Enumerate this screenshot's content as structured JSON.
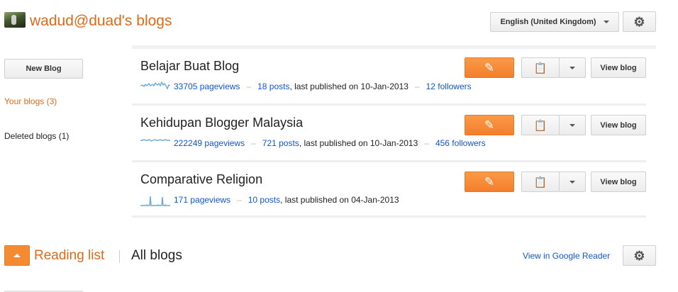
{
  "header": {
    "title": "wadud@duad's blogs",
    "language": "English (United Kingdom)"
  },
  "sidebar": {
    "new_blog": "New Blog",
    "items": [
      {
        "label": "Your blogs (3)",
        "active": true
      },
      {
        "label": "Deleted blogs (1)",
        "active": false
      }
    ]
  },
  "blogs": [
    {
      "title": "Belajar Buat Blog",
      "pageviews": "33705 pageviews",
      "posts": "18 posts",
      "published": ", last published on 10-Jan-2013",
      "followers": "12 followers",
      "view": "View blog"
    },
    {
      "title": "Kehidupan Blogger Malaysia",
      "pageviews": "222249 pageviews",
      "posts": "721 posts",
      "published": ", last published on 10-Jan-2013",
      "followers": "456 followers",
      "view": "View blog"
    },
    {
      "title": "Comparative Religion",
      "pageviews": "171 pageviews",
      "posts": "10 posts",
      "published": ", last published on 04-Jan-2013",
      "followers": "",
      "view": "View blog"
    }
  ],
  "reading": {
    "title": "Reading list",
    "all_blogs": "All blogs",
    "reader_link": "View in Google Reader"
  },
  "icons": {
    "gear": "gear-icon",
    "pencil": "pencil-icon",
    "posts": "posts-list-icon",
    "dropdown": "chevron-down-icon",
    "collapse": "collapse-up-icon"
  },
  "colors": {
    "accent": "#dd6a1b",
    "button_orange": "#f38b32",
    "link": "#1155cc",
    "sparkline": "#6aa9d8"
  }
}
